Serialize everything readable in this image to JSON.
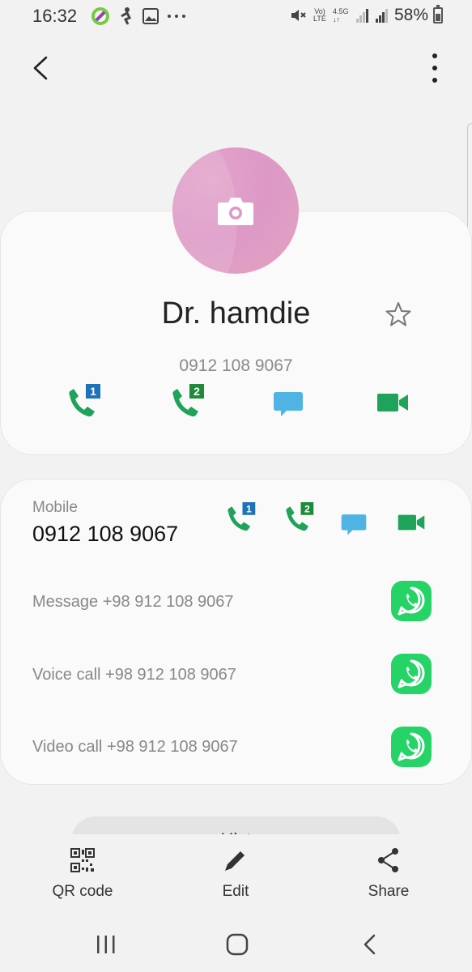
{
  "status_bar": {
    "time": "16:32",
    "battery": "58%",
    "icons": [
      "app-notification-icon",
      "accessibility-icon",
      "gallery-icon",
      "more-notifications-icon",
      "mute-icon",
      "volte-icon",
      "4g-data-icon",
      "signal-icon",
      "signal-icon",
      "battery-icon"
    ],
    "volte_label": "Vo) LTE",
    "data_label": "4.5G"
  },
  "top_bar": {
    "back_icon": "chevron-left-icon",
    "more_icon": "more-vertical-icon"
  },
  "contact": {
    "name": "Dr. hamdie",
    "number": "0912 108 9067",
    "avatar_color": "#dd98c7",
    "favorite_icon": "star-outline-icon"
  },
  "actions": {
    "sim1_badge": "1",
    "sim2_badge": "2",
    "call_color": "#1fa35a",
    "sim1_color": "#1d72b8",
    "sim2_color": "#1f8a3a",
    "message_color": "#4fb3e3",
    "video_color": "#1fa35a"
  },
  "details": {
    "mobile_label": "Mobile",
    "mobile_number": "0912 108 9067",
    "whatsapp_rows": [
      {
        "label": "Message +98 912 108 9067",
        "icon": "whatsapp-icon"
      },
      {
        "label": "Voice call +98 912 108 9067",
        "icon": "whatsapp-icon"
      },
      {
        "label": "Video call +98 912 108 9067",
        "icon": "whatsapp-icon"
      }
    ],
    "whatsapp_color": "#25d366"
  },
  "history_button": {
    "label": "Hist"
  },
  "bottom_toolbar": {
    "qr_label": "QR code",
    "edit_label": "Edit",
    "share_label": "Share"
  },
  "nav_bar": {
    "recents_icon": "recent-apps-icon",
    "home_icon": "home-icon",
    "back_icon": "nav-back-icon"
  }
}
